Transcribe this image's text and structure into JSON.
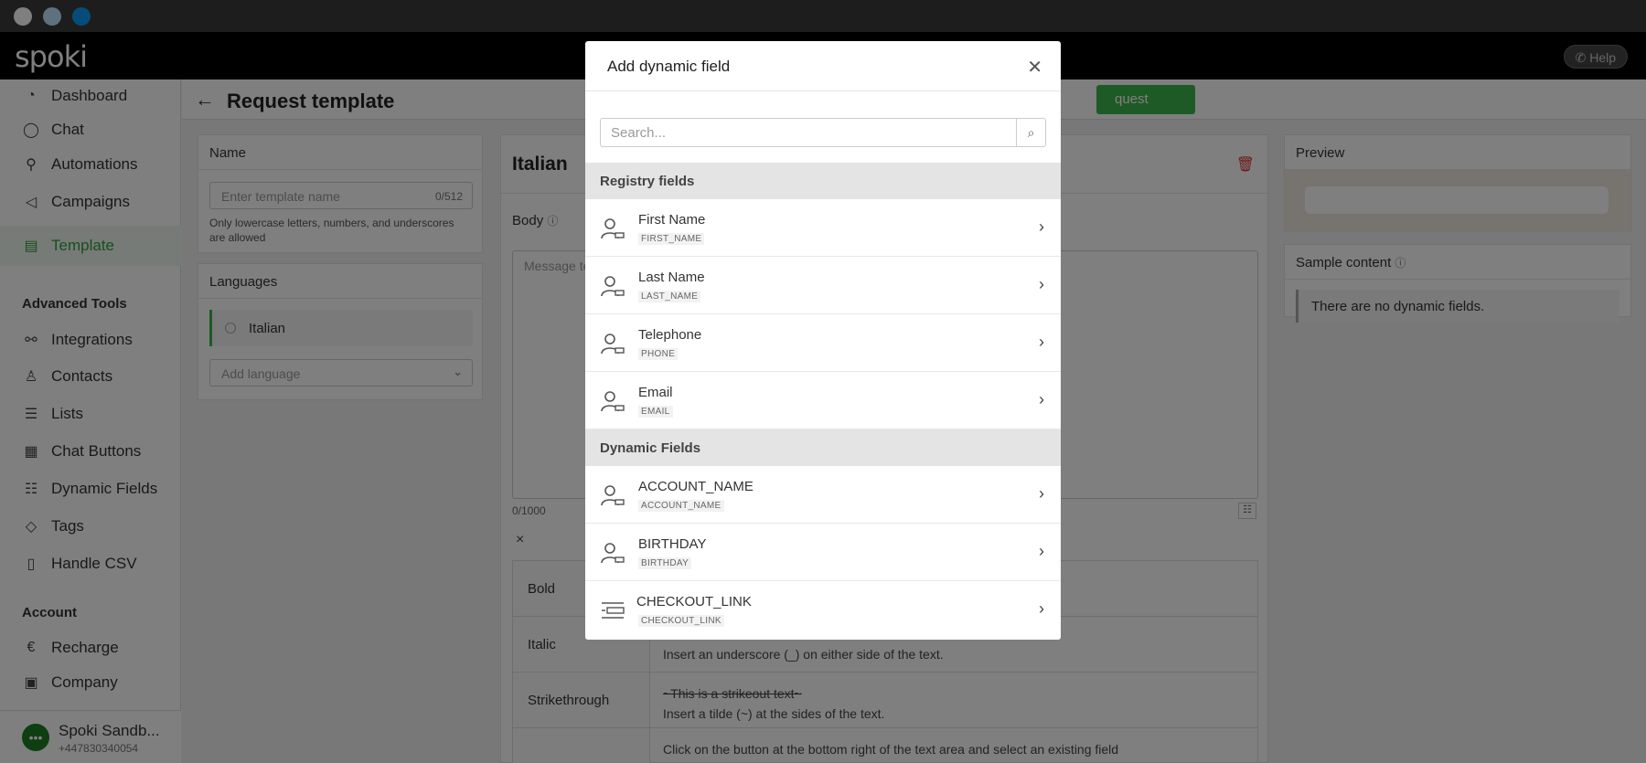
{
  "app": {
    "logo": "spoki",
    "help_label": "Help"
  },
  "sidebar": {
    "items": [
      {
        "label": "Dashboard",
        "icon": "dashboard-icon"
      },
      {
        "label": "Chat",
        "icon": "chat-icon"
      },
      {
        "label": "Automations",
        "icon": "automations-icon"
      },
      {
        "label": "Campaigns",
        "icon": "campaigns-icon"
      },
      {
        "label": "Template",
        "icon": "template-icon"
      }
    ],
    "advanced_title": "Advanced Tools",
    "advanced_items": [
      {
        "label": "Integrations",
        "icon": "integrations-icon"
      },
      {
        "label": "Contacts",
        "icon": "contacts-icon"
      },
      {
        "label": "Lists",
        "icon": "lists-icon"
      },
      {
        "label": "Chat Buttons",
        "icon": "chat-buttons-icon"
      },
      {
        "label": "Dynamic Fields",
        "icon": "dynamic-fields-icon"
      },
      {
        "label": "Tags",
        "icon": "tags-icon"
      },
      {
        "label": "Handle CSV",
        "icon": "csv-icon"
      }
    ],
    "account_title": "Account",
    "account_items": [
      {
        "label": "Recharge",
        "icon": "recharge-icon"
      },
      {
        "label": "Company",
        "icon": "company-icon"
      }
    ],
    "user": {
      "name": "Spoki Sandb...",
      "phone": "+447830340054"
    }
  },
  "page": {
    "title": "Request template",
    "send_label": "quest",
    "name_panel": {
      "title": "Name",
      "placeholder": "Enter template name",
      "counter": "0/512",
      "hint": "Only lowercase letters, numbers, and underscores are allowed"
    },
    "languages_panel": {
      "title": "Languages",
      "selected": "Italian",
      "add_placeholder": "Add language"
    },
    "editor": {
      "language_title": "Italian",
      "body_label": "Body",
      "message_placeholder": "Message te",
      "counter": "0/1000"
    },
    "formatting": [
      {
        "label": "Bold",
        "example": "",
        "description": ""
      },
      {
        "label": "Italic",
        "example": "",
        "description": "Insert an underscore (_) on either side of the text."
      },
      {
        "label": "Strikethrough",
        "example": "~This is a strikeout text~",
        "description": "Insert a tilde (~) at the sides of the text."
      },
      {
        "label": "",
        "example": "",
        "description": "Click on the button at the bottom right of the text area and select an existing field"
      }
    ],
    "preview": {
      "title": "Preview",
      "sample_title": "Sample content",
      "no_fields": "There are no dynamic fields."
    }
  },
  "modal": {
    "title": "Add dynamic field",
    "search_placeholder": "Search...",
    "registry_title": "Registry fields",
    "registry_fields": [
      {
        "name": "First Name",
        "key": "FIRST_NAME"
      },
      {
        "name": "Last Name",
        "key": "LAST_NAME"
      },
      {
        "name": "Telephone",
        "key": "PHONE"
      },
      {
        "name": "Email",
        "key": "EMAIL"
      }
    ],
    "dynamic_title": "Dynamic Fields",
    "dynamic_fields": [
      {
        "name": "ACCOUNT_NAME",
        "key": "ACCOUNT_NAME"
      },
      {
        "name": "BIRTHDAY",
        "key": "BIRTHDAY"
      },
      {
        "name": "CHECKOUT_LINK",
        "key": "CHECKOUT_LINK"
      }
    ]
  },
  "colors": {
    "accent": "#3db54a",
    "topbar": "#000000",
    "overlay": "rgba(0,0,0,0.5)"
  }
}
